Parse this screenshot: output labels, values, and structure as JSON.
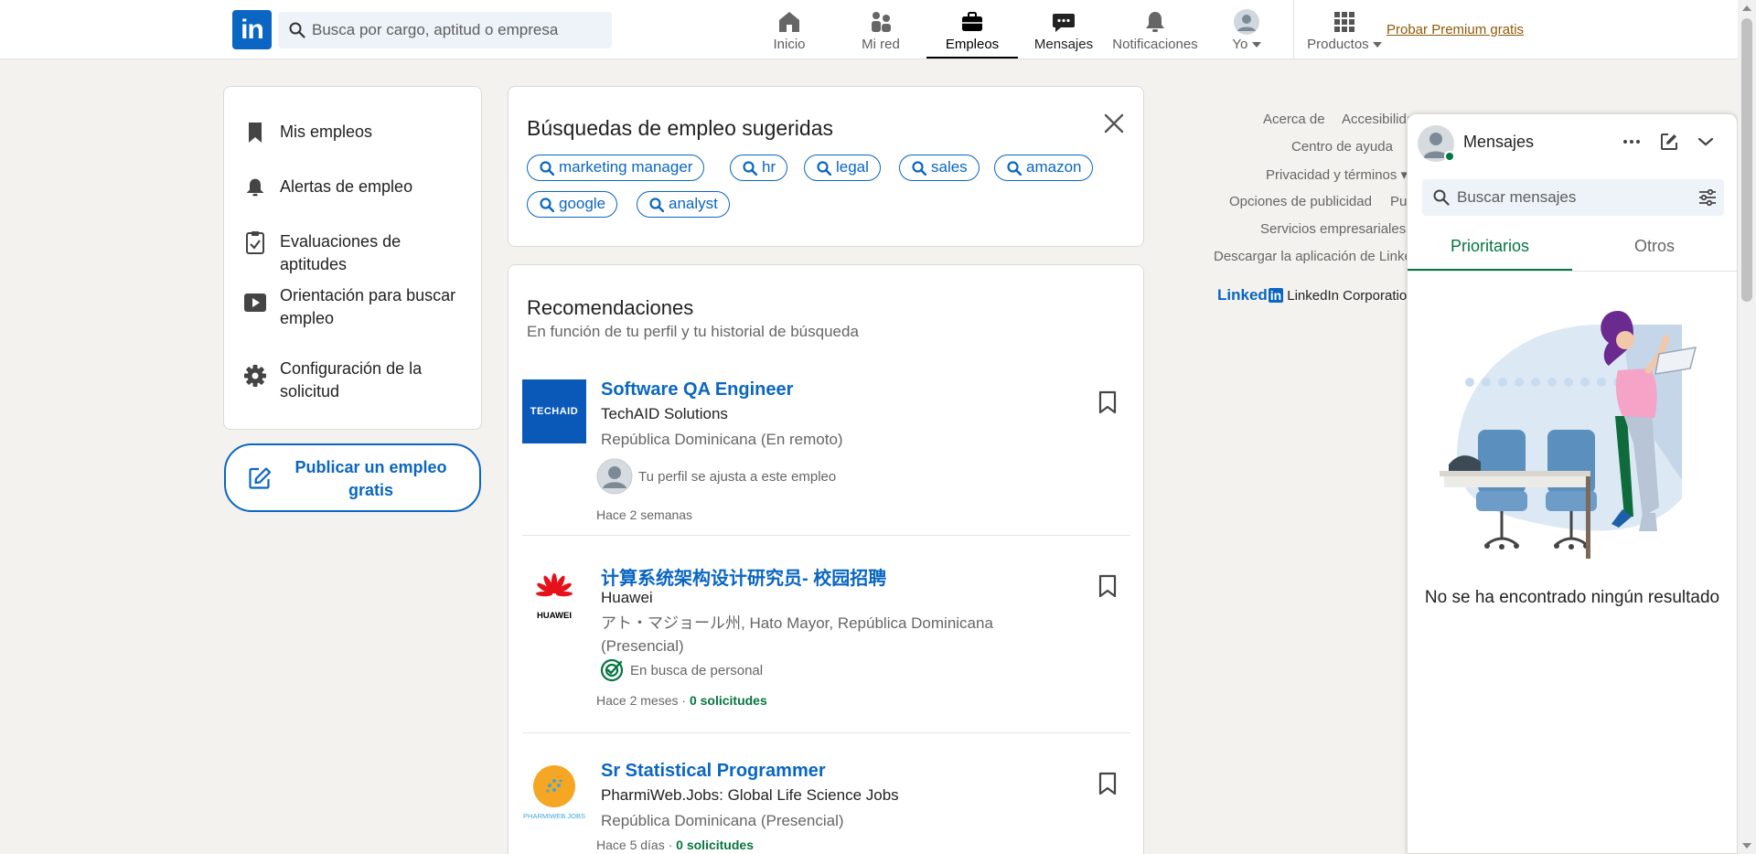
{
  "nav": {
    "search_placeholder": "Busca por cargo, aptitud o empresa",
    "items": [
      {
        "label": "Inicio",
        "icon": "home-icon"
      },
      {
        "label": "Mi red",
        "icon": "network-icon"
      },
      {
        "label": "Empleos",
        "icon": "briefcase-icon"
      },
      {
        "label": "Mensajes",
        "icon": "messages-icon"
      },
      {
        "label": "Notificaciones",
        "icon": "bell-icon"
      },
      {
        "label": "Yo",
        "icon": "avatar"
      },
      {
        "label": "Productos",
        "icon": "grid-icon"
      }
    ],
    "active": "Empleos",
    "premium": "Probar Premium gratis"
  },
  "sidebar": {
    "items": [
      {
        "label": "Mis empleos",
        "icon": "bookmark-icon"
      },
      {
        "label": "Alertas de empleo",
        "icon": "bell-icon"
      },
      {
        "label": "Evaluaciones de aptitudes",
        "icon": "clipboard-check-icon"
      },
      {
        "label": "Orientación para buscar empleo",
        "icon": "video-icon"
      },
      {
        "label": "Configuración de la solicitud",
        "icon": "gear-icon"
      }
    ],
    "post_job": "Publicar un empleo gratis"
  },
  "suggested": {
    "title": "Búsquedas de empleo sugeridas",
    "pills": [
      "marketing manager",
      "hr",
      "legal",
      "sales",
      "amazon",
      "google",
      "analyst"
    ]
  },
  "recommendations": {
    "title": "Recomendaciones",
    "subtitle": "En función de tu perfil y tu historial de búsqueda",
    "jobs": [
      {
        "title": "Software QA Engineer",
        "company": "TechAID Solutions",
        "location": "República Dominicana (En remoto)",
        "insight": "Tu perfil se ajusta a este empleo",
        "posted": "Hace 2 semanas",
        "applicants": "",
        "logo_text": "TECHAID"
      },
      {
        "title": "计算系统架构设计研究员- 校园招聘",
        "company": "Huawei",
        "location": "アト・マジョール州, Hato Mayor, República Dominicana (Presencial)",
        "insight": "En busca de personal",
        "posted": "Hace 2 meses",
        "applicants": "0 solicitudes",
        "logo_text": "HUAWEI"
      },
      {
        "title": "Sr Statistical Programmer",
        "company": "PharmiWeb.Jobs: Global Life Science Jobs",
        "location": "República Dominicana (Presencial)",
        "insight": "",
        "posted": "Hace 5 días",
        "applicants": "0 solicitudes",
        "logo_text": "PHARMIWEB.JOBS"
      }
    ]
  },
  "footer": {
    "links": [
      "Acerca de",
      "Accesibilidad",
      "Centro de ayuda",
      "Privacidad y términos",
      "Opciones de publicidad",
      "Pu",
      "Servicios empresariales",
      "Descargar la aplicación de LinkedIn"
    ],
    "brand": "LinkedIn Corporation"
  },
  "messaging": {
    "title": "Mensajes",
    "search_placeholder": "Buscar mensajes",
    "tabs": [
      "Prioritarios",
      "Otros"
    ],
    "active_tab": "Prioritarios",
    "empty": "No se ha encontrado ningún resultado"
  },
  "colors": {
    "brand": "#0a66c2",
    "green": "#057642",
    "premium": "#915907",
    "background": "#f4f2ee"
  }
}
